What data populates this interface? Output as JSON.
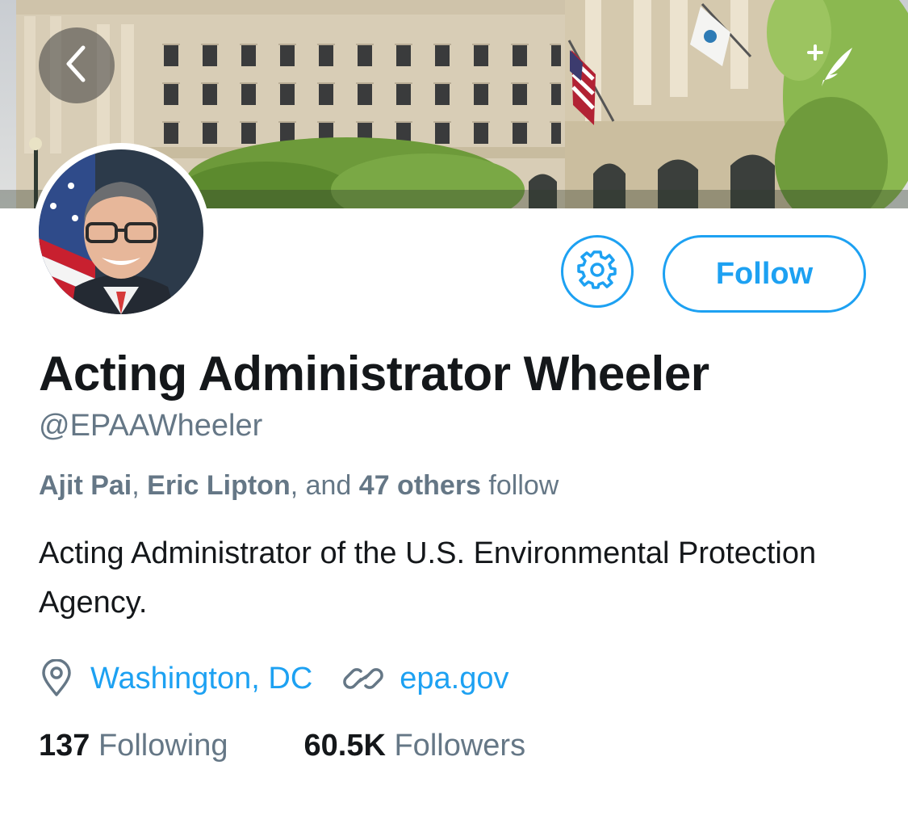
{
  "profile": {
    "name": "Acting Administrator Wheeler",
    "handle": "@EPAAWheeler",
    "followed_by": {
      "first": "Ajit Pai",
      "sep1": ", ",
      "second": "Eric Lipton",
      "sep2": ", and ",
      "others": "47 others",
      "suffix": " follow"
    },
    "bio": "Acting Administrator of the U.S. Environmental Protection Agency.",
    "location": "Washington, DC",
    "website": "epa.gov",
    "following_count": "137",
    "following_label": "Following",
    "followers_count": "60.5K",
    "followers_label": "Followers"
  },
  "actions": {
    "follow_label": "Follow"
  },
  "icons": {
    "back": "chevron-left-icon",
    "compose": "compose-quill-icon",
    "settings": "gear-icon",
    "location": "location-pin-icon",
    "link": "link-icon"
  },
  "colors": {
    "accent": "#1da1f2",
    "primary_text": "#14171a",
    "secondary_text": "#657786"
  }
}
